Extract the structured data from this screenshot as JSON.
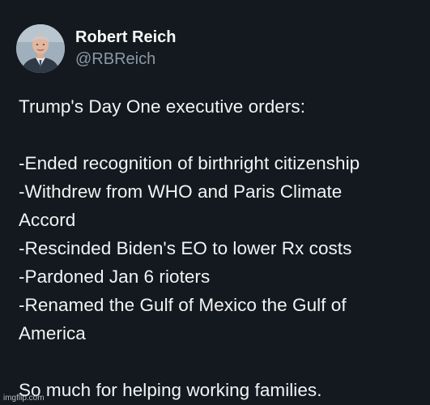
{
  "author": {
    "display_name": "Robert Reich",
    "handle": "@RBReich",
    "avatar_icon": "profile-photo-icon"
  },
  "tweet": {
    "lines": [
      "Trump's Day One executive orders:",
      "",
      "-Ended recognition of birthright citizenship",
      "-Withdrew from WHO and Paris Climate",
      "Accord",
      "-Rescinded Biden's EO to lower Rx costs",
      "-Pardoned Jan 6 rioters",
      "-Renamed the Gulf of Mexico the Gulf of",
      "America",
      "",
      "So much for helping working families."
    ]
  },
  "watermark": "imgflip.com",
  "colors": {
    "background": "#14191f",
    "text": "#f2f4f5",
    "handle": "#8b98a5"
  }
}
